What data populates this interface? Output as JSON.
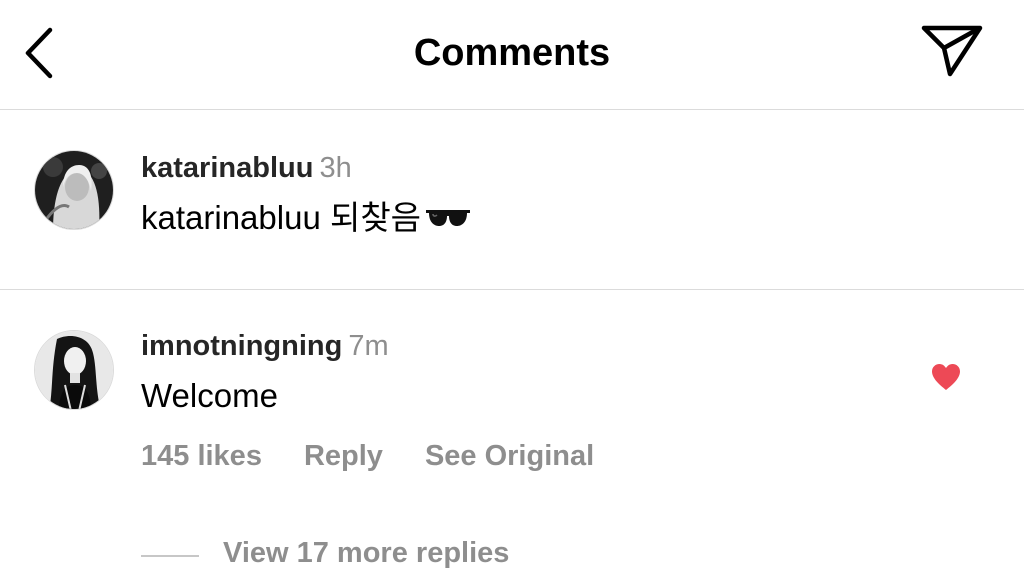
{
  "header": {
    "title": "Comments",
    "back_icon": "chevron-left-icon",
    "send_icon": "paper-plane-icon"
  },
  "caption": {
    "username": "katarinabluu",
    "time": "3h",
    "text": "katarinabluu 되찾음",
    "emoji": "sunglasses-icon"
  },
  "comment": {
    "username": "imnotningning",
    "time": "7m",
    "text": "Welcome",
    "likes": "145 likes",
    "reply_label": "Reply",
    "see_original_label": "See Original",
    "liked": true,
    "heart_color": "#ed4956",
    "view_replies_label": "View 17 more replies"
  }
}
